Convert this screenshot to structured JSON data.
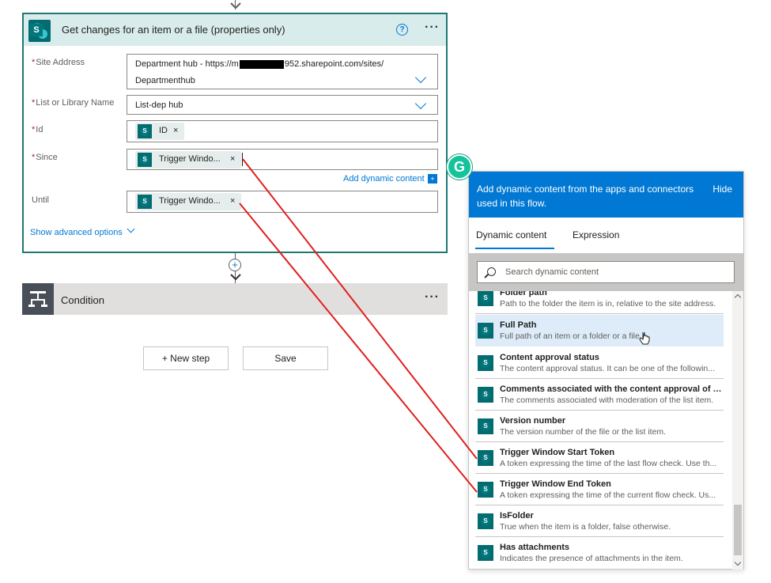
{
  "action_card": {
    "title": "Get changes for an item or a file (properties only)",
    "help_icon": "?",
    "more_icon": "···",
    "site_address_label": "Site Address",
    "site_address_line1": "Department hub - https://m",
    "site_address_line1_suffix": "952.sharepoint.com/sites/",
    "site_address_line2": "Departmenthub",
    "list_label": "List or Library Name",
    "list_value": "List-dep hub",
    "id_label": "Id",
    "id_token": "ID",
    "since_label": "Since",
    "since_token": "Trigger Windo...",
    "add_dynamic_label": "Add dynamic content",
    "until_label": "Until",
    "until_token": "Trigger Windo...",
    "show_advanced_label": "Show advanced options",
    "required_mark": "*",
    "token_remove": "×"
  },
  "condition": {
    "label": "Condition",
    "more_icon": "···"
  },
  "buttons": {
    "new_step": "+ New step",
    "save": "Save"
  },
  "dynamic_panel": {
    "header_text": "Add dynamic content from the apps and connectors used in this flow.",
    "hide_label": "Hide",
    "tabs": [
      "Dynamic content",
      "Expression"
    ],
    "search_placeholder": "Search dynamic content",
    "items": [
      {
        "name": "Folder path",
        "desc": "Path to the folder the item is in, relative to the site address."
      },
      {
        "name": "Full Path",
        "desc": "Full path of an item or a folder or a file."
      },
      {
        "name": "Content approval status",
        "desc": "The content approval status. It can be one of the followin..."
      },
      {
        "name": "Comments associated with the content approval of this...",
        "desc": "The comments associated with moderation of the list item."
      },
      {
        "name": "Version number",
        "desc": "The version number of the file or the list item."
      },
      {
        "name": "Trigger Window Start Token",
        "desc": "A token expressing the time of the last flow check. Use th..."
      },
      {
        "name": "Trigger Window End Token",
        "desc": "A token expressing the time of the current flow check. Us..."
      },
      {
        "name": "IsFolder",
        "desc": "True when the item is a folder, false otherwise."
      },
      {
        "name": "Has attachments",
        "desc": "Indicates the presence of attachments in the item."
      }
    ]
  },
  "grammarly_badge": "G",
  "colors": {
    "accent": "#0078d4",
    "card_border": "#1e7875",
    "card_header": "#d8eceb",
    "sharepoint": "#036c70",
    "annotation_line": "#e02020",
    "grammarly": "#15c39a"
  },
  "icons": [
    "sharepoint-icon",
    "help-icon",
    "more-icon",
    "chevron-down-icon",
    "condition-icon",
    "search-icon",
    "plus-circle-icon",
    "arrow-down-icon"
  ]
}
